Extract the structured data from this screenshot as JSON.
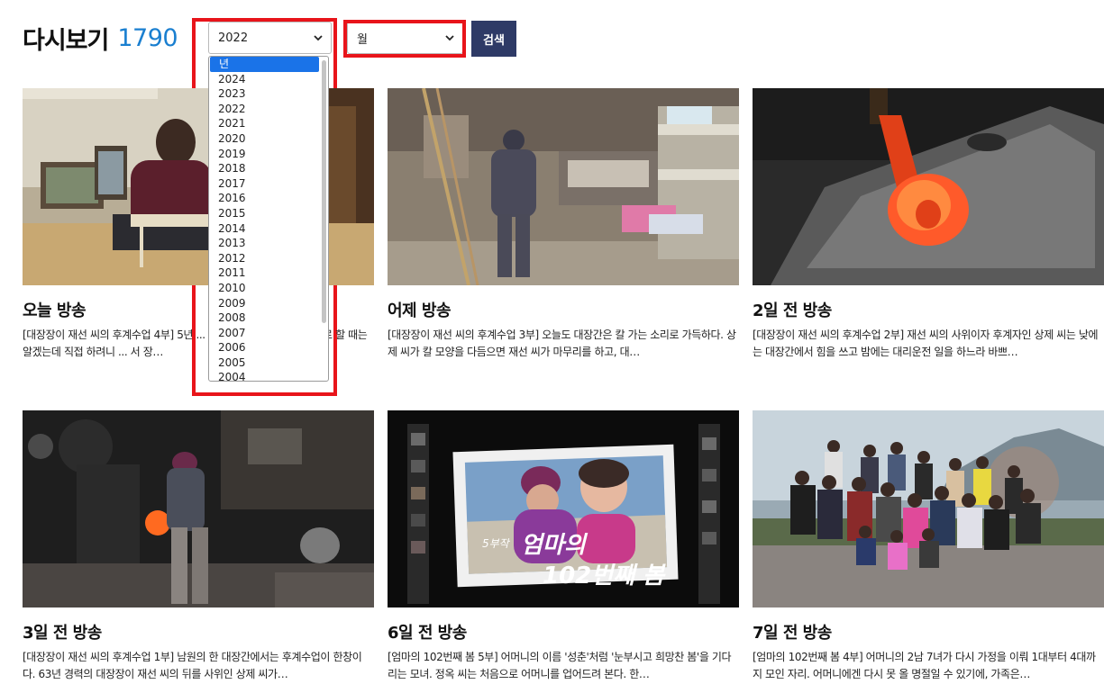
{
  "header": {
    "title": "다시보기",
    "count": "1790"
  },
  "filters": {
    "year_value": "2022",
    "month_value": "월",
    "search_label": "검색",
    "year_options": [
      "년",
      "2024",
      "2023",
      "2022",
      "2021",
      "2020",
      "2019",
      "2018",
      "2017",
      "2016",
      "2015",
      "2014",
      "2013",
      "2012",
      "2011",
      "2010",
      "2009",
      "2008",
      "2007",
      "2006",
      "2005",
      "2004"
    ]
  },
  "episodes": [
    {
      "title": "오늘 방송",
      "desc": "[대장장이 재선 씨의 후계수업 4부] 5년 ... 재선 씨. 상제 씨. 어깨너머로 할 때는 알겠는데 직접 하려니 ... 서 장…"
    },
    {
      "title": "어제 방송",
      "desc": "[대장장이 재선 씨의 후계수업 3부] 오늘도 대장간은 칼 가는 소리로 가득하다. 상제 씨가 칼 모양을 다듬으면 재선 씨가 마무리를 하고, 대…"
    },
    {
      "title": "2일 전 방송",
      "desc": "[대장장이 재선 씨의 후계수업 2부] 재선 씨의 사위이자 후계자인 상제 씨는 낮에는 대장간에서 힘을 쓰고 밤에는 대리운전 일을 하느라 바쁘…"
    },
    {
      "title": "3일 전 방송",
      "desc": "[대장장이 재선 씨의 후계수업 1부] 남원의 한 대장간에서는 후계수업이 한창이다. 63년 경력의 대장장이 재선 씨의 뒤를 사위인 상제 씨가…"
    },
    {
      "title": "6일 전 방송",
      "desc": "[엄마의 102번째 봄 5부] 어머니의 이름 '성춘'처럼 '눈부시고 희망찬 봄'을 기다리는 모녀. 정옥 씨는 처음으로 어머니를 업어드려 본다. 한…"
    },
    {
      "title": "7일 전 방송",
      "desc": "[엄마의 102번째 봄 4부] 어머니의 2남 7녀가 다시 가정을 이뤄 1대부터 4대까지 모인 자리. 어머니에겐 다시 못 올 명절일 수 있기에, 가족은…"
    }
  ],
  "thumb4_caption": {
    "prefix": "5부작",
    "title_line1": "엄마의",
    "title_line2": "102번째 봄"
  },
  "colors": {
    "accent": "#1a7fd0",
    "button": "#2e3a66",
    "highlight": "#e8141a",
    "selected": "#1a73e8"
  }
}
